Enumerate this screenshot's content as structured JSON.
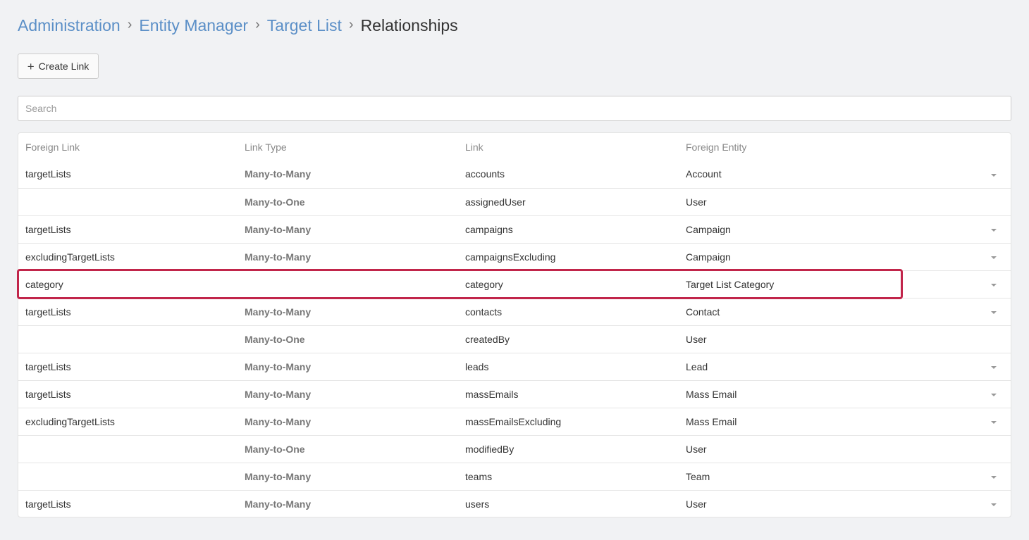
{
  "breadcrumb": {
    "items": [
      "Administration",
      "Entity Manager",
      "Target List"
    ],
    "current": "Relationships",
    "separator": "›"
  },
  "toolbar": {
    "create_label": "Create Link",
    "create_icon": "plus-icon"
  },
  "search": {
    "placeholder": "Search",
    "value": ""
  },
  "table": {
    "headers": [
      "Foreign Link",
      "Link Type",
      "Link",
      "Foreign Entity"
    ],
    "rows": [
      {
        "foreign_link": "targetLists",
        "type": "Many-to-Many",
        "link": "accounts",
        "entity": "Account",
        "menu": true
      },
      {
        "foreign_link": "",
        "type": "Many-to-One",
        "link": "assignedUser",
        "entity": "User",
        "menu": false
      },
      {
        "foreign_link": "targetLists",
        "type": "Many-to-Many",
        "link": "campaigns",
        "entity": "Campaign",
        "menu": true
      },
      {
        "foreign_link": "excludingTargetLists",
        "type": "Many-to-Many",
        "link": "campaignsExcluding",
        "entity": "Campaign",
        "menu": true
      },
      {
        "foreign_link": "category",
        "type": "",
        "link": "category",
        "entity": "Target List Category",
        "menu": true
      },
      {
        "foreign_link": "targetLists",
        "type": "Many-to-Many",
        "link": "contacts",
        "entity": "Contact",
        "menu": true
      },
      {
        "foreign_link": "",
        "type": "Many-to-One",
        "link": "createdBy",
        "entity": "User",
        "menu": false
      },
      {
        "foreign_link": "targetLists",
        "type": "Many-to-Many",
        "link": "leads",
        "entity": "Lead",
        "menu": true
      },
      {
        "foreign_link": "targetLists",
        "type": "Many-to-Many",
        "link": "massEmails",
        "entity": "Mass Email",
        "menu": true
      },
      {
        "foreign_link": "excludingTargetLists",
        "type": "Many-to-Many",
        "link": "massEmailsExcluding",
        "entity": "Mass Email",
        "menu": true
      },
      {
        "foreign_link": "",
        "type": "Many-to-One",
        "link": "modifiedBy",
        "entity": "User",
        "menu": false
      },
      {
        "foreign_link": "",
        "type": "Many-to-Many",
        "link": "teams",
        "entity": "Team",
        "menu": true
      },
      {
        "foreign_link": "targetLists",
        "type": "Many-to-Many",
        "link": "users",
        "entity": "User",
        "menu": true
      }
    ]
  },
  "highlight": {
    "row_index": 4,
    "color": "#c1254a"
  },
  "colors": {
    "link": "#5b8fc7",
    "background": "#f1f2f4"
  }
}
